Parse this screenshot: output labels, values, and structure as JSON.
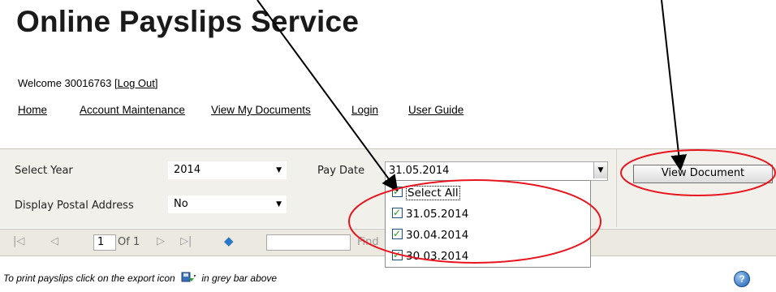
{
  "header": {
    "title": "Online Payslips Service"
  },
  "welcome": {
    "prefix": "Welcome 30016763 [",
    "logout": "Log Out",
    "suffix": "]"
  },
  "nav": {
    "items": [
      "Home",
      "Account Maintenance",
      "View My Documents",
      "Login",
      "User Guide"
    ]
  },
  "form": {
    "select_year_label": "Select Year",
    "select_year_value": "2014",
    "postal_label": "Display Postal Address",
    "postal_value": "No",
    "pay_date_label": "Pay Date",
    "pay_date_value": "31.05.2014",
    "view_button": "View Document"
  },
  "dropdown": {
    "items": [
      "Select All",
      "31.05.2014",
      "30.04.2014",
      "30.03.2014"
    ]
  },
  "toolbar": {
    "page_value": "1",
    "of_label": "Of 1",
    "find_label": "Find"
  },
  "footnote": {
    "before": "To print payslips click on the export icon",
    "after": "in grey bar above"
  },
  "icons": [
    "first-page-icon",
    "prev-page-icon",
    "next-page-icon",
    "last-page-icon",
    "back-icon",
    "export-icon",
    "help-icon",
    "dropdown-arrow-icon"
  ],
  "colors": {
    "annotation_red": "#e8141e",
    "panel_bg": "#f2f0ea",
    "link_blue": "#000000"
  }
}
